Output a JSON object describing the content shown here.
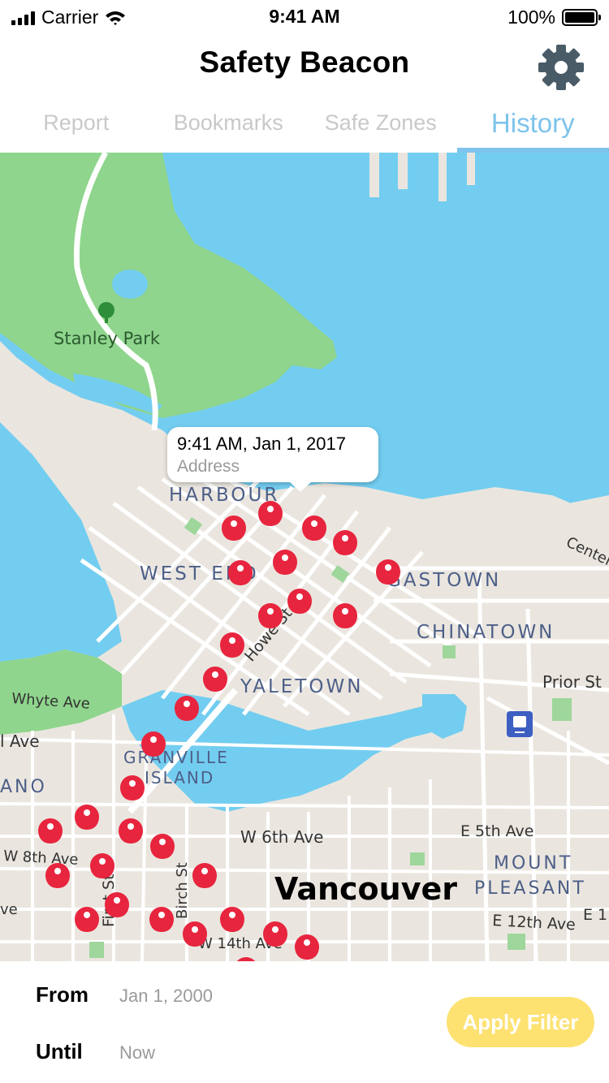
{
  "status_bar": {
    "carrier": "Carrier",
    "time": "9:41 AM",
    "battery": "100%"
  },
  "header": {
    "title": "Safety Beacon",
    "settings_icon": "gear-icon"
  },
  "tabs": [
    {
      "label": "Report",
      "active": false
    },
    {
      "label": "Bookmarks",
      "active": false
    },
    {
      "label": "Safe Zones",
      "active": false
    },
    {
      "label": "History",
      "active": true
    }
  ],
  "map": {
    "labels": {
      "stanley_park": "Stanley Park",
      "harbour": "HARBOUR",
      "west_end": "WEST END",
      "gastown": "GASTOWN",
      "chinatown": "CHINATOWN",
      "howe_st": "Howe St",
      "yaletown": "YALETOWN",
      "prior_st": "Prior St",
      "whyte_ave": "Whyte Ave",
      "ave_fragment": "l Ave",
      "granville": "GRANVILLE",
      "island": "ISLAND",
      "ano": "ANO",
      "w6th": "W 6th Ave",
      "e5th": "E 5th Ave",
      "w8th": "W 8th Ave",
      "mount": "MOUNT",
      "pleasant": "PLEASANT",
      "vancouver": "Vancouver",
      "first_st": "First St",
      "birch_st": "Birch St",
      "e12th": "E 12th Ave",
      "w14th": "W 14th Ave",
      "ve_fragment": "ve",
      "center_fragment": "Center",
      "e1_fragment": "E 1"
    },
    "callout": {
      "time": "9:41 AM, Jan 1, 2017",
      "address": "Address"
    },
    "colors": {
      "water": "#73cdf0",
      "park": "#8fd58d",
      "land": "#eae6df",
      "road": "#ffffff",
      "pin": "#e8253e"
    }
  },
  "filter": {
    "from_label": "From",
    "from_value": "Jan 1, 2000",
    "until_label": "Until",
    "until_value": "Now",
    "apply_label": "Apply Filter",
    "apply_color": "#fde272"
  }
}
